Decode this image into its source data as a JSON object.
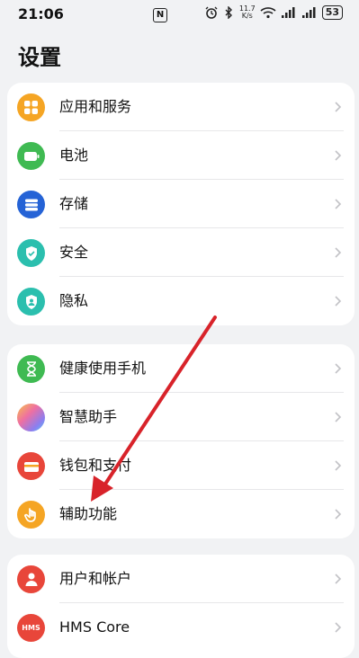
{
  "status_bar": {
    "time": "21:06",
    "nfc": "N",
    "speed_top": "11.7",
    "speed_bottom": "K/s",
    "battery": "53"
  },
  "page": {
    "title": "设置"
  },
  "groups": [
    {
      "items": [
        {
          "label": "应用和服务",
          "icon": "apps-icon",
          "color": "#f5a524"
        },
        {
          "label": "电池",
          "icon": "battery-icon",
          "color": "#3fba52"
        },
        {
          "label": "存储",
          "icon": "storage-icon",
          "color": "#2563d6"
        },
        {
          "label": "安全",
          "icon": "shield-icon",
          "color": "#2bbfae"
        },
        {
          "label": "隐私",
          "icon": "privacy-icon",
          "color": "#2bbfae"
        }
      ]
    },
    {
      "items": [
        {
          "label": "健康使用手机",
          "icon": "hourglass-icon",
          "color": "#3fba52"
        },
        {
          "label": "智慧助手",
          "icon": "assistant-icon",
          "color": "#b98ae0"
        },
        {
          "label": "钱包和支付",
          "icon": "wallet-icon",
          "color": "#e8463a"
        },
        {
          "label": "辅助功能",
          "icon": "hand-icon",
          "color": "#f5a524"
        }
      ]
    },
    {
      "items": [
        {
          "label": "用户和帐户",
          "icon": "user-icon",
          "color": "#e8463a"
        },
        {
          "label": "HMS Core",
          "icon": "hms-icon",
          "color": "#e8463a",
          "icon_text": "HMS"
        }
      ]
    }
  ]
}
